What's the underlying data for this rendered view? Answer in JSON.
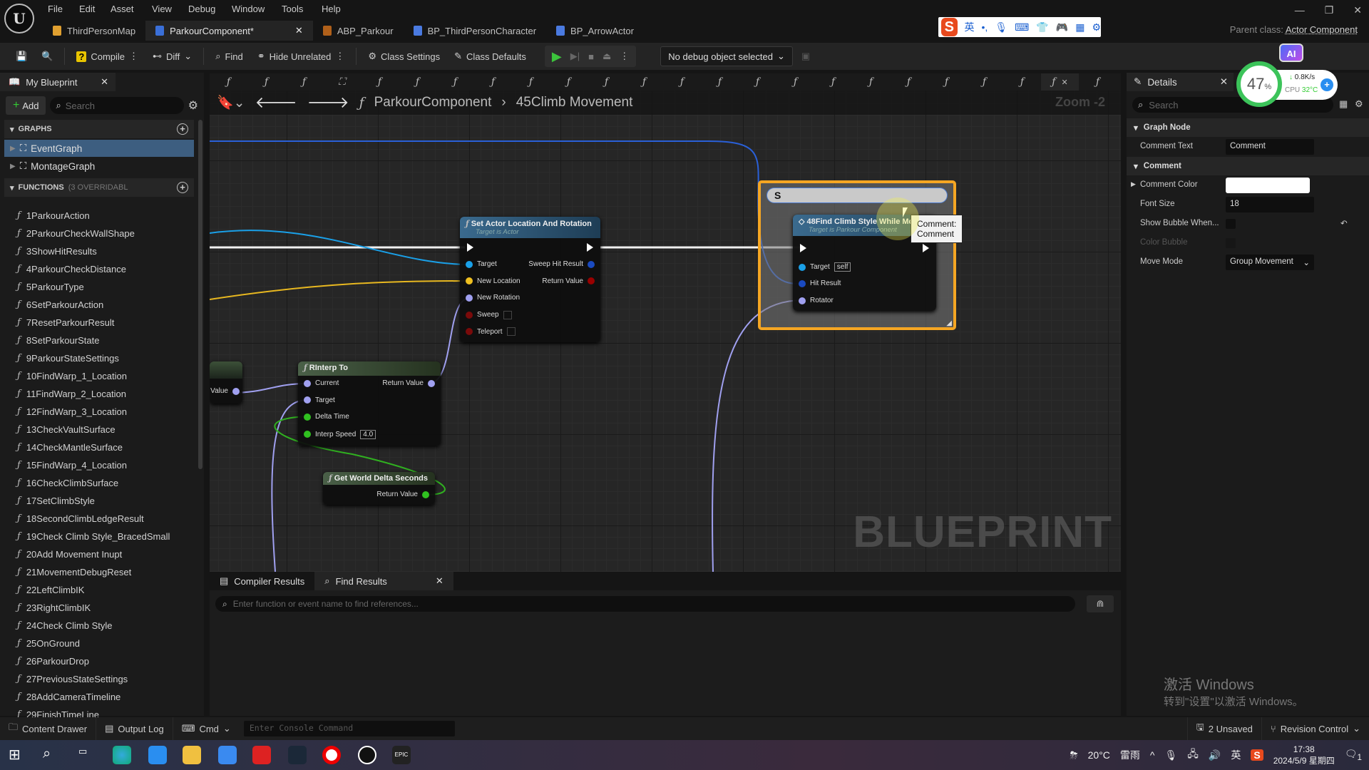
{
  "menu": [
    "File",
    "Edit",
    "Asset",
    "View",
    "Debug",
    "Window",
    "Tools",
    "Help"
  ],
  "doc_tabs": [
    {
      "label": "ThirdPersonMap",
      "color": "#e0a030"
    },
    {
      "label": "ParkourComponent*",
      "color": "#3a6fd8",
      "active": true
    },
    {
      "label": "ABP_Parkour",
      "color": "#b0601a"
    },
    {
      "label": "BP_ThirdPersonCharacter",
      "color": "#4a7ae0"
    },
    {
      "label": "BP_ArrowActor",
      "color": "#4a7ae0"
    }
  ],
  "parent_class": {
    "label": "Parent class:",
    "value": "Actor Component"
  },
  "toolbar": {
    "compile": "Compile",
    "diff": "Diff",
    "find": "Find",
    "hide_unrelated": "Hide Unrelated",
    "class_settings": "Class Settings",
    "class_defaults": "Class Defaults",
    "debug_object": "No debug object selected"
  },
  "overlay": {
    "ai": "AI",
    "percent": "47",
    "pct_unit": "%",
    "net": "0.8K/s",
    "cpu_label": "CPU",
    "cpu_temp": "32°C"
  },
  "my_blueprint": {
    "title": "My Blueprint",
    "add": "Add",
    "search_placeholder": "Search",
    "graphs_header": "GRAPHS",
    "graphs": [
      "EventGraph",
      "MontageGraph"
    ],
    "functions_header": "FUNCTIONS",
    "functions_note": "(3 OVERRIDABL",
    "functions": [
      "1ParkourAction",
      "2ParkourCheckWallShape",
      "3ShowHitResults",
      "4ParkourCheckDistance",
      "5ParkourType",
      "6SetParkourAction",
      "7ResetParkourResult",
      "8SetParkourState",
      "9ParkourStateSettings",
      "10FindWarp_1_Location",
      "11FindWarp_2_Location",
      "12FindWarp_3_Location",
      "13CheckVaultSurface",
      "14CheckMantleSurface",
      "15FindWarp_4_Location",
      "16CheckClimbSurface",
      "17SetClimbStyle",
      "18SecondClimbLedgeResult",
      "19Check Climb Style_BracedSmall",
      "20Add Movement Inupt",
      "21MovementDebugReset",
      "22LeftClimbIK",
      "23RightClimbIK",
      "24Check Climb Style",
      "25OnGround",
      "26ParkourDrop",
      "27PreviousStateSettings",
      "28AddCameraTimeline",
      "29FinishTimeLine"
    ]
  },
  "graph_tabs": [
    "function-icon",
    "function-icon",
    "function-icon",
    "graph-icon",
    "function-icon",
    "function-icon",
    "function-icon",
    "function-icon",
    "function-icon",
    "function-icon",
    "function-icon",
    "function-icon",
    "function-icon",
    "function-icon",
    "function-icon",
    "function-icon",
    "function-icon",
    "function-icon",
    "function-icon",
    "function-icon",
    "function-icon",
    "function-icon",
    "function-icon-active",
    "function-icon"
  ],
  "breadcrumb": [
    "ParkourComponent",
    "45Climb Movement"
  ],
  "zoom": "Zoom -2",
  "watermark": "BLUEPRINT",
  "nodes": {
    "set_actor": {
      "title": "Set Actor Location And Rotation",
      "subtitle": "Target is Actor",
      "inputs": [
        {
          "label": "Target",
          "color": "#1aa0e8"
        },
        {
          "label": "New Location",
          "color": "#f0c020"
        },
        {
          "label": "New Rotation",
          "color": "#a0a0f0"
        },
        {
          "label": "Sweep",
          "color": "#7a0a0a"
        },
        {
          "label": "Teleport",
          "color": "#7a0a0a"
        }
      ],
      "outputs": [
        {
          "label": "Sweep Hit Result",
          "color": "#1a4ac0"
        },
        {
          "label": "Return Value",
          "color": "#900"
        }
      ]
    },
    "rinterp": {
      "title": "RInterp To",
      "inputs": [
        {
          "label": "Current",
          "color": "#a0a0f0"
        },
        {
          "label": "Target",
          "color": "#a0a0f0"
        },
        {
          "label": "Delta Time",
          "color": "#30c020"
        },
        {
          "label": "Interp Speed",
          "color": "#30c020",
          "value": "4.0"
        }
      ],
      "outputs": [
        {
          "label": "Return Value",
          "color": "#a0a0f0"
        }
      ]
    },
    "delta": {
      "title": "Get World Delta Seconds",
      "outputs": [
        {
          "label": "Return Value",
          "color": "#30c020"
        }
      ]
    },
    "partial": {
      "outputs": [
        {
          "label": "Value",
          "color": "#a0a0f0"
        }
      ]
    },
    "find_climb": {
      "title": "48Find Climb Style While Movi",
      "subtitle": "Target is Parkour Component",
      "inputs": [
        {
          "label": "Target",
          "color": "#1aa0e8",
          "value": "self"
        },
        {
          "label": "Hit Result",
          "color": "#1a4ac0"
        },
        {
          "label": "Rotator",
          "color": "#a0a0f0"
        }
      ]
    }
  },
  "comment": {
    "text": "S",
    "tooltip_line1": "Comment:",
    "tooltip_line2": "Comment",
    "color": "#f5a623"
  },
  "bottom_panel": {
    "tabs": [
      "Compiler Results",
      "Find Results"
    ],
    "search_placeholder": "Enter function or event name to find references..."
  },
  "details": {
    "title": "Details",
    "search_placeholder": "Search",
    "sections": [
      {
        "title": "Graph Node",
        "rows": [
          {
            "label": "Comment Text",
            "value": "Comment"
          }
        ]
      },
      {
        "title": "Comment",
        "rows": [
          {
            "label": "Comment Color",
            "value": ""
          },
          {
            "label": "Font Size",
            "value": "18"
          },
          {
            "label": "Show Bubble When...",
            "value": ""
          },
          {
            "label": "Color Bubble",
            "value": ""
          },
          {
            "label": "Move Mode",
            "value": "Group Movement"
          }
        ]
      }
    ]
  },
  "statusbar": {
    "content_drawer": "Content Drawer",
    "output_log": "Output Log",
    "cmd": "Cmd",
    "console_placeholder": "Enter Console Command",
    "unsaved": "2 Unsaved",
    "revision_control": "Revision Control"
  },
  "windows_activation": {
    "line1": "激活 Windows",
    "line2": "转到\"设置\"以激活 Windows。"
  },
  "taskbar": {
    "weather": "20°C",
    "weather_desc": "雷雨",
    "ime": "英",
    "time": "17:38",
    "date": "2024/5/9 星期四",
    "notifications": "1"
  }
}
